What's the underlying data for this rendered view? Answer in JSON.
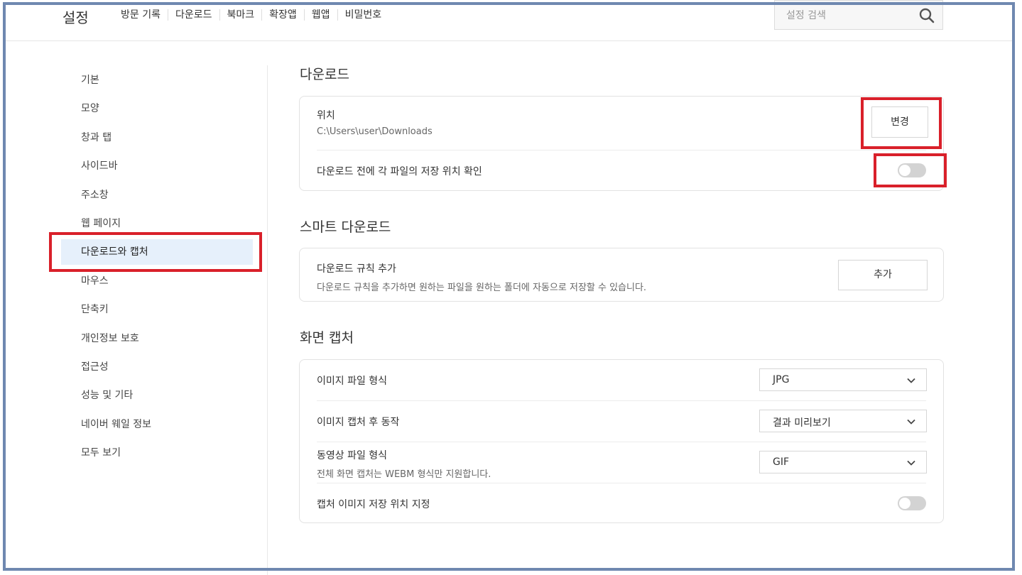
{
  "header": {
    "title": "설정",
    "nav": [
      "방문 기록",
      "다운로드",
      "북마크",
      "확장앱",
      "웹앱",
      "비밀번호"
    ],
    "search_placeholder": "설정 검색",
    "search_icon": "search-icon"
  },
  "sidebar": {
    "items": [
      {
        "label": "기본"
      },
      {
        "label": "모양"
      },
      {
        "label": "창과 탭"
      },
      {
        "label": "사이드바"
      },
      {
        "label": "주소창"
      },
      {
        "label": "웹 페이지"
      },
      {
        "label": "다운로드와 캡처",
        "active": true
      },
      {
        "label": "마우스"
      },
      {
        "label": "단축키"
      },
      {
        "label": "개인정보 보호"
      },
      {
        "label": "접근성"
      },
      {
        "label": "성능 및 기타"
      },
      {
        "label": "네이버 웨일 정보"
      },
      {
        "label": "모두 보기"
      }
    ]
  },
  "download": {
    "title": "다운로드",
    "location_label": "위치",
    "location_path": "C:\\Users\\user\\Downloads",
    "change_button": "변경",
    "ask_location_label": "다운로드 전에 각 파일의 저장 위치 확인",
    "ask_location_enabled": false
  },
  "smart_download": {
    "title": "스마트 다운로드",
    "rule_label": "다운로드 규칙 추가",
    "rule_desc": "다운로드 규칙을 추가하면 원하는 파일을 원하는 폴더에 자동으로 저장할 수 있습니다.",
    "add_button": "추가"
  },
  "capture": {
    "title": "화면 캡처",
    "image_format_label": "이미지 파일 형식",
    "image_format_value": "JPG",
    "after_capture_label": "이미지 캡처 후 동작",
    "after_capture_value": "결과 미리보기",
    "video_format_label": "동영상 파일 형식",
    "video_format_desc": "전체 화면 캡처는 WEBM 형식만 지원합니다.",
    "video_format_value": "GIF",
    "save_location_label": "캡처 이미지 저장 위치 지정",
    "save_location_enabled": false
  },
  "colors": {
    "highlight": "#d9202a",
    "frame": "#6f88b0",
    "active_bg": "#e6f0fb"
  }
}
